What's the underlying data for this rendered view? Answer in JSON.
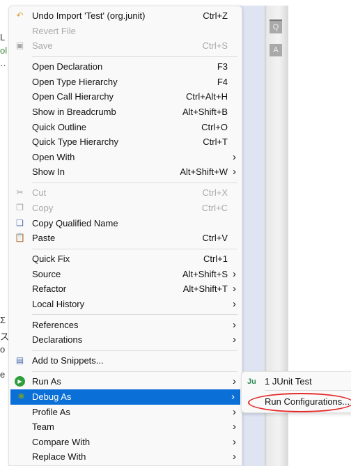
{
  "background_fragments": [
    "L",
    "ol",
    "··",
    "Σ",
    "ス",
    "o",
    "e"
  ],
  "ruler": {
    "buttons": [
      {
        "icon": "search-icon",
        "glyph": "Q"
      },
      {
        "icon": "annotation-icon",
        "glyph": "A"
      }
    ]
  },
  "menu": {
    "items": [
      {
        "type": "item",
        "label": "Undo Import 'Test' (org.junit)",
        "shortcut": "Ctrl+Z",
        "icon": "undo-icon",
        "glyph": "↶"
      },
      {
        "type": "item",
        "label": "Revert File",
        "disabled": true
      },
      {
        "type": "item",
        "label": "Save",
        "shortcut": "Ctrl+S",
        "disabled": true,
        "icon": "save-icon",
        "glyph": "▣"
      },
      {
        "type": "separator"
      },
      {
        "type": "item",
        "label": "Open Declaration",
        "shortcut": "F3"
      },
      {
        "type": "item",
        "label": "Open Type Hierarchy",
        "shortcut": "F4"
      },
      {
        "type": "item",
        "label": "Open Call Hierarchy",
        "shortcut": "Ctrl+Alt+H"
      },
      {
        "type": "item",
        "label": "Show in Breadcrumb",
        "shortcut": "Alt+Shift+B"
      },
      {
        "type": "item",
        "label": "Quick Outline",
        "shortcut": "Ctrl+O"
      },
      {
        "type": "item",
        "label": "Quick Type Hierarchy",
        "shortcut": "Ctrl+T"
      },
      {
        "type": "item",
        "label": "Open With",
        "submenu": true
      },
      {
        "type": "item",
        "label": "Show In",
        "shortcut": "Alt+Shift+W",
        "submenu": true
      },
      {
        "type": "separator"
      },
      {
        "type": "item",
        "label": "Cut",
        "shortcut": "Ctrl+X",
        "disabled": true,
        "icon": "scissors-icon",
        "glyph": "✂"
      },
      {
        "type": "item",
        "label": "Copy",
        "shortcut": "Ctrl+C",
        "disabled": true,
        "icon": "copy-icon",
        "glyph": "❐"
      },
      {
        "type": "item",
        "label": "Copy Qualified Name",
        "icon": "copy-qualified-name-icon",
        "glyph": "❏"
      },
      {
        "type": "item",
        "label": "Paste",
        "shortcut": "Ctrl+V",
        "icon": "paste-icon",
        "glyph": "📋"
      },
      {
        "type": "separator"
      },
      {
        "type": "item",
        "label": "Quick Fix",
        "shortcut": "Ctrl+1"
      },
      {
        "type": "item",
        "label": "Source",
        "shortcut": "Alt+Shift+S",
        "submenu": true
      },
      {
        "type": "item",
        "label": "Refactor",
        "shortcut": "Alt+Shift+T",
        "submenu": true
      },
      {
        "type": "item",
        "label": "Local History",
        "submenu": true
      },
      {
        "type": "separator"
      },
      {
        "type": "item",
        "label": "References",
        "submenu": true
      },
      {
        "type": "item",
        "label": "Declarations",
        "submenu": true
      },
      {
        "type": "separator"
      },
      {
        "type": "item",
        "label": "Add to Snippets...",
        "icon": "snippets-icon",
        "glyph": "▤"
      },
      {
        "type": "separator"
      },
      {
        "type": "item",
        "label": "Run As",
        "submenu": true,
        "icon": "run-icon",
        "glyph": "▶"
      },
      {
        "type": "item",
        "label": "Debug As",
        "submenu": true,
        "selected": true,
        "icon": "debug-bug-icon",
        "glyph": "✱"
      },
      {
        "type": "item",
        "label": "Profile As",
        "submenu": true
      },
      {
        "type": "item",
        "label": "Team",
        "submenu": true
      },
      {
        "type": "item",
        "label": "Compare With",
        "submenu": true
      },
      {
        "type": "item",
        "label": "Replace With",
        "submenu": true
      }
    ]
  },
  "submenu": {
    "items": [
      {
        "label": "1 JUnit Test",
        "icon": "junit-icon",
        "glyph": "Ju"
      },
      {
        "label": "Run Configurations..."
      }
    ]
  },
  "colors": {
    "selection": "#0a6fd6",
    "annotation_ellipse": "#e52a2a",
    "run_icon": "#2e9e3a",
    "undo_icon": "#e0a030"
  }
}
